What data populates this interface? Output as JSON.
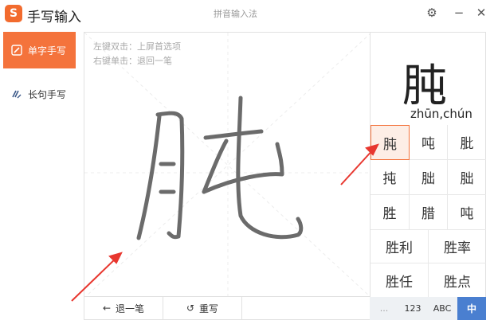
{
  "title_bar": {
    "logo_glyph": "S",
    "app_title": "手写输入",
    "window_caption": "拼音输入法",
    "settings_icon": "gear-icon",
    "minimize_icon": "minus-icon",
    "close_icon": "close-icon"
  },
  "sidebar": {
    "items": [
      {
        "label": "单字手写",
        "icon": "pencil-icon",
        "active": true
      },
      {
        "label": "长句手写",
        "icon": "sentence-pen-icon",
        "active": false
      }
    ]
  },
  "writing_pad": {
    "hint_line1": "左键双击：上屏首选项",
    "hint_line2": "右键单击：退回一笔"
  },
  "bottom_actions": {
    "undo_label": "退一笔",
    "undo_icon": "arrow-left-icon",
    "rewrite_label": "重写",
    "rewrite_icon": "refresh-icon"
  },
  "candidates": {
    "preview_char": "肫",
    "preview_pinyin": "zhūn,chún",
    "chars": [
      "肫",
      "吨",
      "肶",
      "扽",
      "朏",
      "朏",
      "胜",
      "腊",
      "吨"
    ],
    "words": [
      "胜利",
      "胜率",
      "胜任",
      "胜点"
    ]
  },
  "input_modes": {
    "modes": [
      "...",
      "123",
      "ABC",
      "中"
    ],
    "active": "中"
  },
  "colors": {
    "accent": "#f4733c",
    "stroke": "#6b6b6b",
    "annotation_arrow": "#e8372f",
    "mode_active": "#4a7fd0"
  }
}
